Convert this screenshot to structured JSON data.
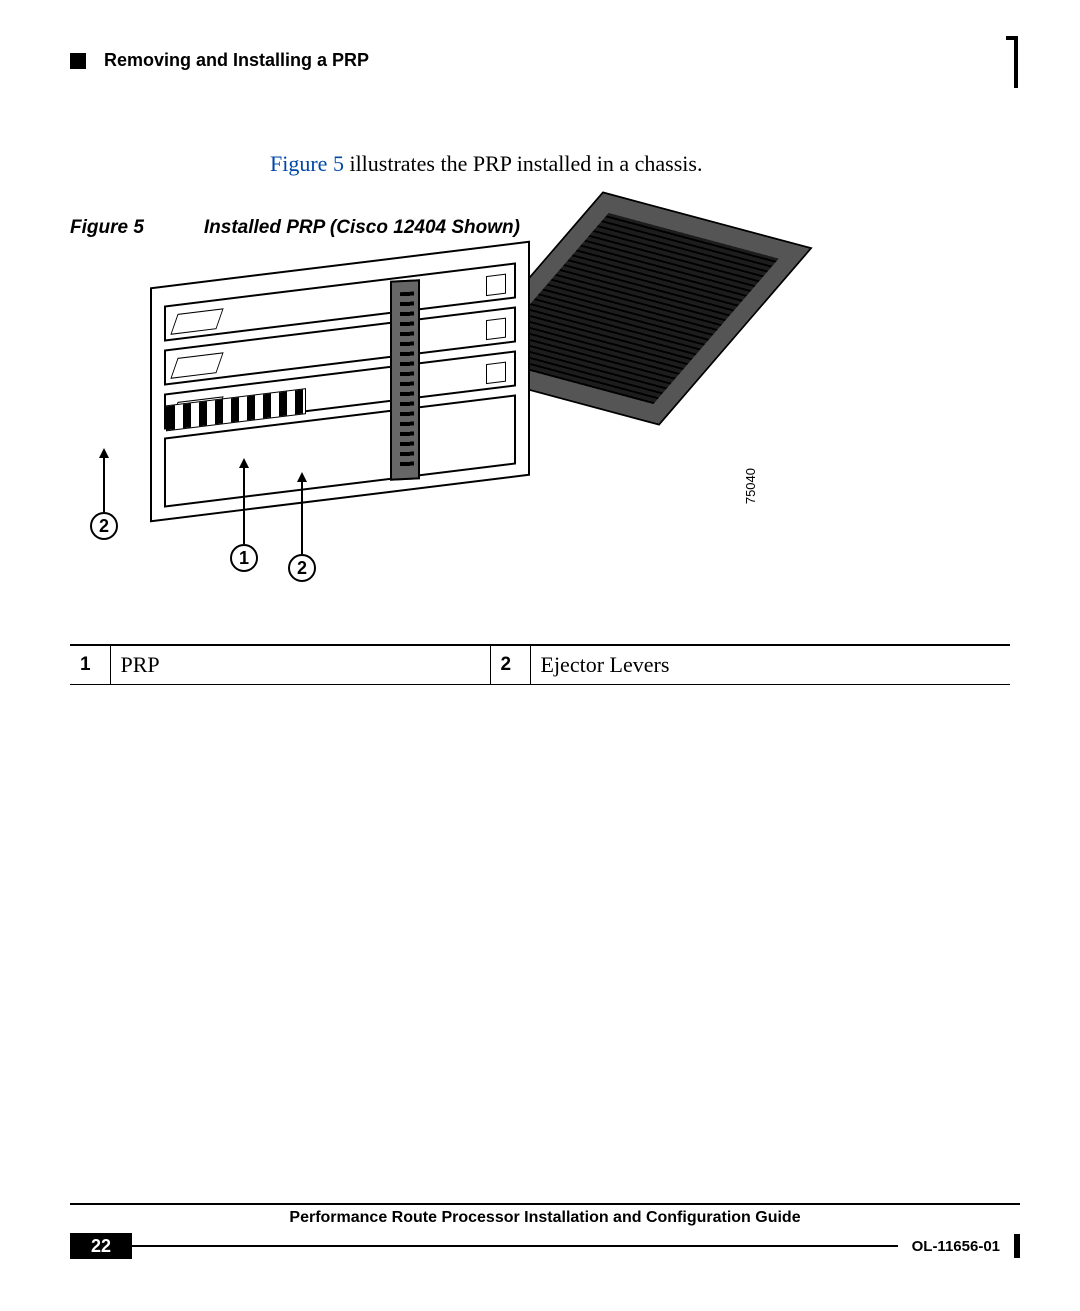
{
  "header": {
    "section_title": "Removing and Installing a PRP"
  },
  "body": {
    "intro_link": "Figure 5",
    "intro_rest": " illustrates the PRP installed in a chassis."
  },
  "figure": {
    "label": "Figure 5",
    "title": "Installed PRP (Cisco 12404 Shown)",
    "image_id": "75040",
    "callouts": {
      "left": "2",
      "mid": "1",
      "right": "2"
    }
  },
  "legend": [
    {
      "num": "1",
      "label": "PRP"
    },
    {
      "num": "2",
      "label": "Ejector Levers"
    }
  ],
  "footer": {
    "guide_title": "Performance Route Processor Installation and Configuration Guide",
    "page_number": "22",
    "doc_id": "OL-11656-01"
  }
}
